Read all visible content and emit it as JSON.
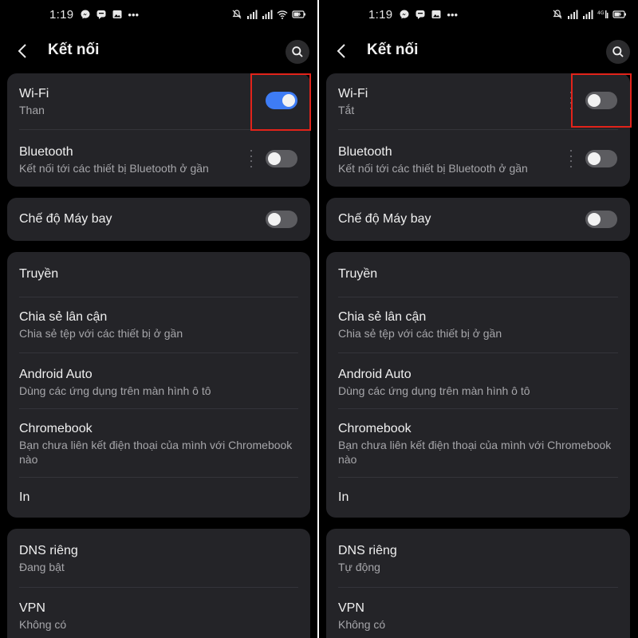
{
  "left": {
    "status": {
      "time": "1:19",
      "more": "•••"
    },
    "header": {
      "title": "Kết nối"
    },
    "wifi": {
      "label": "Wi-Fi",
      "state": "Than",
      "enabled": true
    },
    "bluetooth": {
      "label": "Bluetooth",
      "desc": "Kết nối tới các thiết bị Bluetooth ở gần",
      "enabled": false
    },
    "airplane": {
      "label": "Chế độ Máy bay",
      "enabled": false
    },
    "more_items": [
      {
        "label": "Truyền"
      },
      {
        "label": "Chia sẻ lân cận",
        "desc": "Chia sẻ tệp với các thiết bị ở gần"
      },
      {
        "label": "Android Auto",
        "desc": "Dùng các ứng dụng trên màn hình ô tô"
      },
      {
        "label": "Chromebook",
        "desc": "Bạn chưa liên kết điện thoại của mình với Chromebook nào"
      },
      {
        "label": "In"
      }
    ],
    "network": [
      {
        "label": "DNS riêng",
        "desc": "Đang bật"
      },
      {
        "label": "VPN",
        "desc": "Không có"
      }
    ]
  },
  "right": {
    "status": {
      "time": "1:19",
      "more": "•••"
    },
    "header": {
      "title": "Kết nối"
    },
    "wifi": {
      "label": "Wi-Fi",
      "state": "Tắt",
      "enabled": false
    },
    "bluetooth": {
      "label": "Bluetooth",
      "desc": "Kết nối tới các thiết bị Bluetooth ở gần",
      "enabled": false
    },
    "airplane": {
      "label": "Chế độ Máy bay",
      "enabled": false
    },
    "more_items": [
      {
        "label": "Truyền"
      },
      {
        "label": "Chia sẻ lân cận",
        "desc": "Chia sẻ tệp với các thiết bị ở gần"
      },
      {
        "label": "Android Auto",
        "desc": "Dùng các ứng dụng trên màn hình ô tô"
      },
      {
        "label": "Chromebook",
        "desc": "Bạn chưa liên kết điện thoại của mình với Chromebook nào"
      },
      {
        "label": "In"
      }
    ],
    "network": [
      {
        "label": "DNS riêng",
        "desc": "Tự động"
      },
      {
        "label": "VPN",
        "desc": "Không có"
      }
    ]
  },
  "colors": {
    "background": "#000000",
    "card": "#242428",
    "toggle_on": "#3e7cf5",
    "toggle_off": "#5c5c60",
    "highlight": "#e2231a"
  }
}
